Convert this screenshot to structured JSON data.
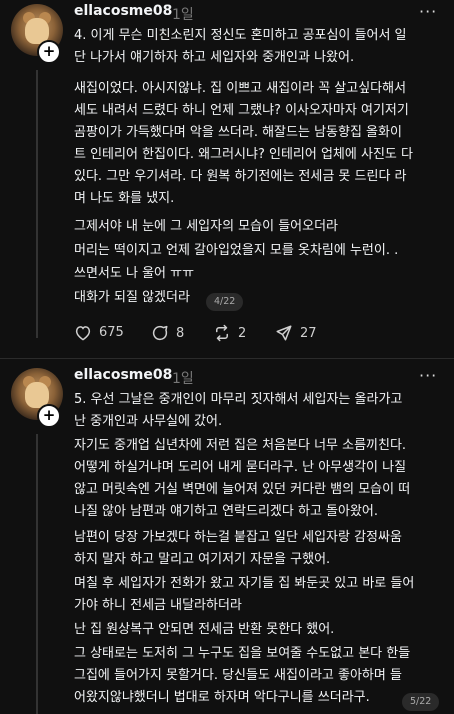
{
  "post1": {
    "username": "ellacosme08",
    "time": "1일",
    "more": "···",
    "lines_a": [
      "4. 이게 무슨 미친소린지 정신도 혼미하고 공포심이 들어서 일",
      "단 나가서 얘기하자 하고 세입자와 중개인과 나왔어."
    ],
    "lines_b": [
      "새집이었다. 아시지않냐. 집 이쁘고 새집이라 꼭 살고싶다해서",
      "세도 내려서 드렸다 하니 언제 그랬냐? 이사오자마자 여기저기",
      "곰팡이가 가득했다며 악을 쓰더라. 해잘드는 남동향집 올화이",
      "트 인테리어 한집이다. 왜그러시냐? 인테리어 업체에 사진도 다",
      "있다. 그만 우기셔라. 다 원복 하기전에는 전세금 못 드린다 라",
      "며 나도 화를 냈지."
    ],
    "lines_c": [
      "그제서야 내 눈에 그 세입자의 모습이 들어오더라",
      "머리는 떡이지고 언제 갈아입었을지 모를 옷차림에 누런이. .",
      "쓰면서도 나 울어 ㅠㅠ",
      "대화가 되질 않겠더라"
    ],
    "badge": "4/22",
    "likes": "675",
    "comments": "8",
    "reposts": "2",
    "shares": "27"
  },
  "post2": {
    "username": "ellacosme08",
    "time": "1일",
    "more": "···",
    "lines_a": [
      "5. 우선 그날은 중개인이 마무리 짓자해서 세입자는 올라가고",
      "난 중개인과 사무실에 갔어."
    ],
    "lines_b": [
      "자기도 중개업 십년차에 저런 집은 처음본다 너무 소름끼친다.",
      "어떻게 하실거냐며 도리어 내게 묻더라구. 난 아무생각이 나질",
      "않고 머릿속엔 거실 벽면에 늘어져 있던 커다란 뱀의 모습이 떠",
      "나질 않아 남편과 얘기하고 연락드리겠다 하고 돌아왔어."
    ],
    "lines_c": [
      "남편이 당장 가보겠다 하는걸 붙잡고 일단 세입자랑 감정싸움",
      "하지 말자 하고 말리고 여기저기 자문을 구했어."
    ],
    "lines_d": [
      "며칠 후 세입자가 전화가 왔고 자기들 집 봐둔곳 있고 바로 들어",
      "가야 하니 전세금 내달라하더라"
    ],
    "lines_e": [
      "난 집 원상복구 안되면 전세금 반환 못한다 했어."
    ],
    "lines_f": [
      "그 상태로는 도저히 그 누구도 집을 보여줄 수도없고 본다 한들",
      "그집에 들어가지 못할거다. 당신들도 새집이라고 좋아하며 들",
      "어왔지않냐했더니 법대로 하자며 악다구니를 쓰더라구."
    ],
    "badge": "5/22"
  }
}
